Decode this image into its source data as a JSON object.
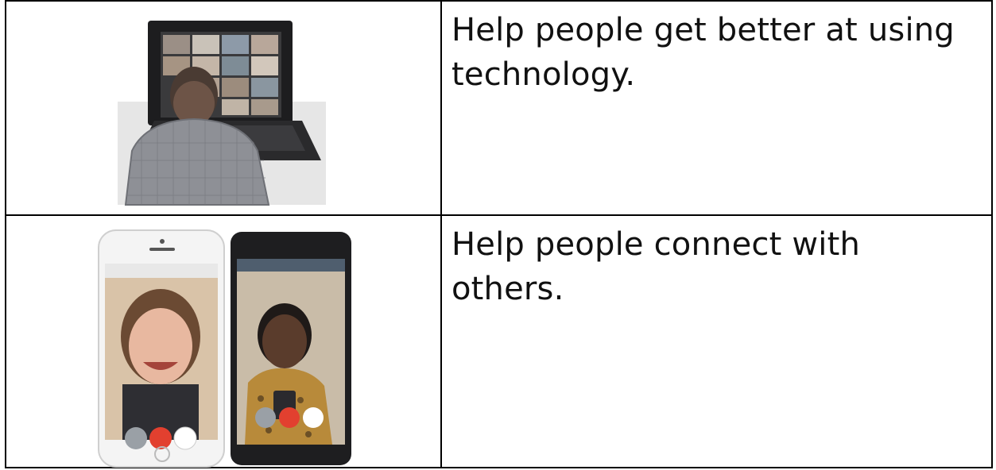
{
  "rows": [
    {
      "text": "Help people get better at using technology.",
      "image_icon": "person-laptop-video-call"
    },
    {
      "text": "Help people connect with others.",
      "image_icon": "phones-video-call"
    }
  ],
  "colors": {
    "border": "#000000",
    "text": "#111111",
    "end_call": "#e2402f"
  }
}
